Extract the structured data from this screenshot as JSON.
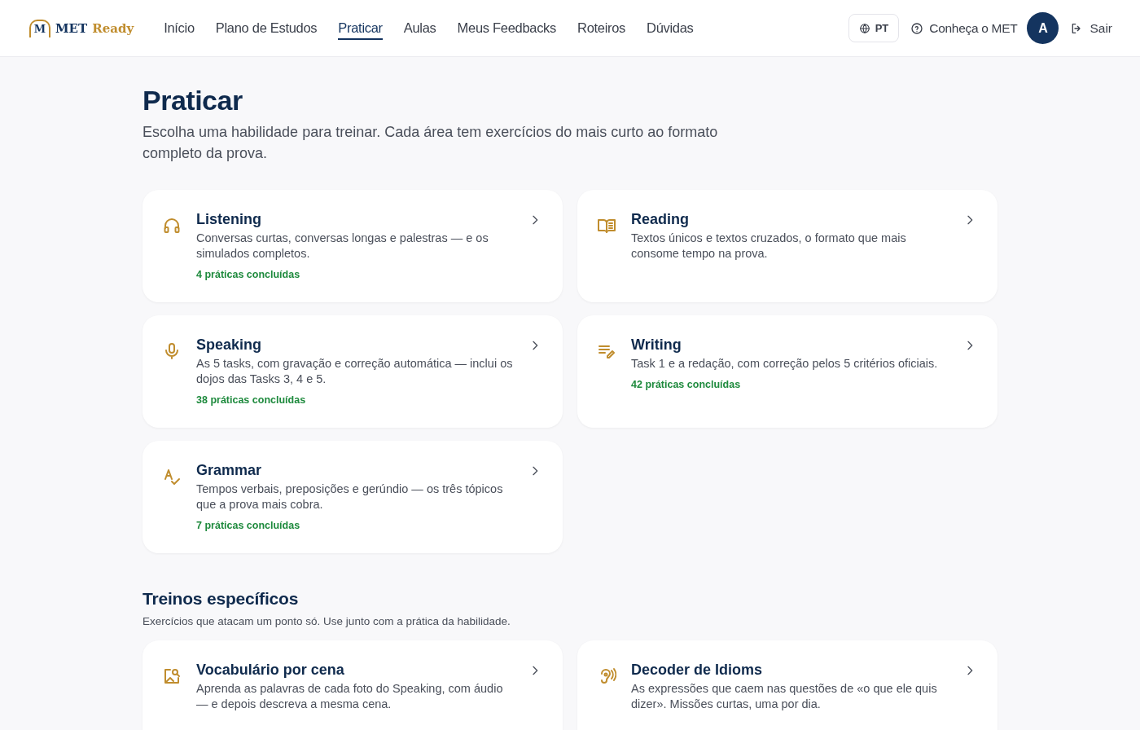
{
  "logo": {
    "mark": "M",
    "name": "MET",
    "accent": "Ready"
  },
  "nav": [
    {
      "label": "Início",
      "selected": false
    },
    {
      "label": "Plano de Estudos",
      "selected": false
    },
    {
      "label": "Praticar",
      "selected": true
    },
    {
      "label": "Aulas",
      "selected": false
    },
    {
      "label": "Meus Feedbacks",
      "selected": false
    },
    {
      "label": "Roteiros",
      "selected": false
    },
    {
      "label": "Dúvidas",
      "selected": false
    }
  ],
  "language": "PT",
  "about": "Conheça o MET",
  "avatar": "A",
  "logout": "Sair",
  "page": {
    "title": "Praticar",
    "subtitle": "Escolha uma habilidade para treinar. Cada área tem exercícios do mais curto ao formato completo da prova."
  },
  "skills": [
    {
      "title": "Listening",
      "description": "Conversas curtas, conversas longas e palestras — e os simulados completos.",
      "progress": "4 práticas concluídas"
    },
    {
      "title": "Reading",
      "description": "Textos únicos e textos cruzados, o formato que mais consome tempo na prova."
    },
    {
      "title": "Speaking",
      "description": "As 5 tasks, com gravação e correção automática — inclui os dojos das Tasks 3, 4 e 5.",
      "progress": "38 práticas concluídas"
    },
    {
      "title": "Writing",
      "description": "Task 1 e a redação, com correção pelos 5 critérios oficiais.",
      "progress": "42 práticas concluídas"
    },
    {
      "title": "Grammar",
      "description": "Tempos verbais, preposições e gerúndio — os três tópicos que a prova mais cobra.",
      "progress": "7 práticas concluídas"
    }
  ],
  "specific": {
    "title": "Treinos específicos",
    "subtitle": "Exercícios que atacam um ponto só. Use junto com a prática da habilidade.",
    "items": [
      {
        "title": "Vocabulário por cena",
        "description": "Aprenda as palavras de cada foto do Speaking, com áudio — e depois descreva a mesma cena."
      },
      {
        "title": "Decoder de Idioms",
        "description": "As expressões que caem nas questões de «o que ele quis dizer». Missões curtas, uma por dia."
      }
    ]
  }
}
